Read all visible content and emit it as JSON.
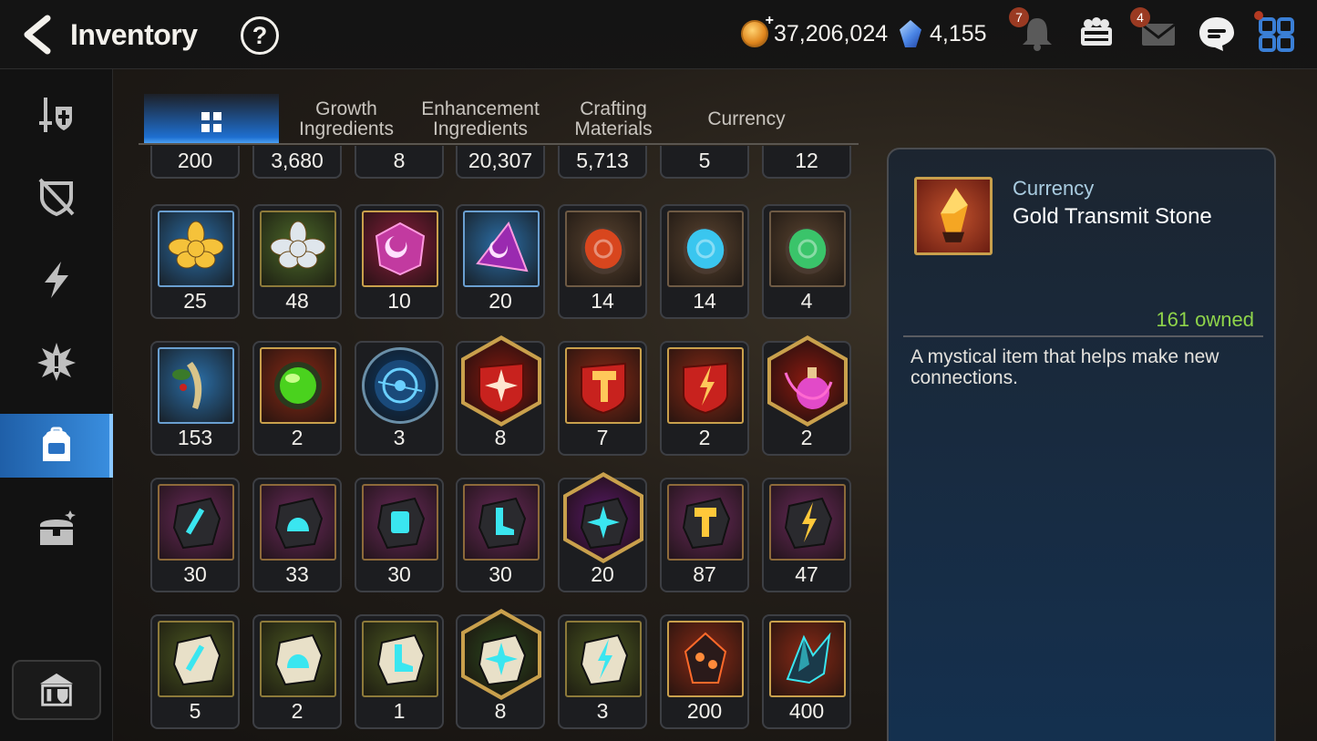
{
  "header": {
    "title": "Inventory",
    "help_label": "?",
    "gold": "37,206,024",
    "crystals": "4,155",
    "notification_count": "7",
    "mail_count": "4"
  },
  "sidebar": {
    "items": [
      {
        "icon": "sword-shield-icon"
      },
      {
        "icon": "broken-shield-icon"
      },
      {
        "icon": "lightning-icon"
      },
      {
        "icon": "burst-icon"
      },
      {
        "icon": "backpack-icon",
        "active": true
      },
      {
        "icon": "treasure-chest-icon"
      }
    ],
    "bottom_icon": "shop-building-icon"
  },
  "tabs": [
    {
      "label": "",
      "icon": "grid-icon",
      "active": true
    },
    {
      "label": "Growth Ingredients"
    },
    {
      "label": "Enhancement Ingredients"
    },
    {
      "label": "Crafting Materials"
    },
    {
      "label": "Currency"
    }
  ],
  "items": [
    {
      "count": "200",
      "style": "plain"
    },
    {
      "count": "3,680",
      "style": "plain"
    },
    {
      "count": "8",
      "style": "plain"
    },
    {
      "count": "20,307",
      "style": "plain"
    },
    {
      "count": "5,713",
      "style": "plain"
    },
    {
      "count": "5",
      "style": "plain"
    },
    {
      "count": "12",
      "style": "plain"
    },
    {
      "count": "25",
      "icon": "gold-flower-icon",
      "bg": "#2b6fa8",
      "style": "blue"
    },
    {
      "count": "48",
      "icon": "silver-flower-icon",
      "bg": "#4d6a2a",
      "style": "green"
    },
    {
      "count": "10",
      "icon": "purple-moon-crystal-icon",
      "bg": "#8a1e3c",
      "style": "red"
    },
    {
      "count": "20",
      "icon": "purple-triangle-crystal-icon",
      "bg": "#2b6fa8",
      "style": "blue"
    },
    {
      "count": "14",
      "icon": "red-rune-stone-icon",
      "bg": "#5a4430",
      "style": "brown"
    },
    {
      "count": "14",
      "icon": "blue-rune-stone-icon",
      "bg": "#5a4430",
      "style": "brown"
    },
    {
      "count": "4",
      "icon": "green-rune-stone-icon",
      "bg": "#5a4430",
      "style": "brown"
    },
    {
      "count": "153",
      "icon": "ginseng-root-icon",
      "bg": "#2b6fa8",
      "style": "blue"
    },
    {
      "count": "2",
      "icon": "green-gem-icon",
      "bg": "#8a2a16",
      "style": "red"
    },
    {
      "count": "3",
      "icon": "blue-circuit-orb-icon",
      "bg": "#0e3a66",
      "style": "round"
    },
    {
      "count": "8",
      "icon": "red-star-shield-icon",
      "bg": "#8a1a10",
      "style": "hex"
    },
    {
      "count": "7",
      "icon": "red-hammer-shield-icon",
      "bg": "#8a2a16",
      "style": "red"
    },
    {
      "count": "2",
      "icon": "red-bolt-shield-icon",
      "bg": "#8a2a16",
      "style": "red"
    },
    {
      "count": "2",
      "icon": "pink-potion-icon",
      "bg": "#8a1a10",
      "style": "hex"
    },
    {
      "count": "30",
      "icon": "cyan-sword-stone-icon",
      "bg": "#6a2a5a",
      "style": "purple"
    },
    {
      "count": "33",
      "icon": "cyan-helmet-stone-icon",
      "bg": "#6a2a5a",
      "style": "purple"
    },
    {
      "count": "30",
      "icon": "cyan-armor-stone-icon",
      "bg": "#6a2a5a",
      "style": "purple"
    },
    {
      "count": "30",
      "icon": "cyan-boot-stone-icon",
      "bg": "#6a2a5a",
      "style": "purple"
    },
    {
      "count": "20",
      "icon": "cyan-star-stone-icon",
      "bg": "#5a1a6a",
      "style": "hex"
    },
    {
      "count": "87",
      "icon": "gold-hammer-stone-icon",
      "bg": "#6a2a5a",
      "style": "purple"
    },
    {
      "count": "47",
      "icon": "gold-bolt-stone-icon",
      "bg": "#6a2a5a",
      "style": "purple"
    },
    {
      "count": "5",
      "icon": "white-sword-stone-icon",
      "bg": "#4d5a22",
      "style": "green"
    },
    {
      "count": "2",
      "icon": "white-helmet-stone-icon",
      "bg": "#4d5a22",
      "style": "green"
    },
    {
      "count": "1",
      "icon": "white-boot-stone-icon",
      "bg": "#4d5a22",
      "style": "green"
    },
    {
      "count": "8",
      "icon": "white-star-stone-icon",
      "bg": "#2a4a1e",
      "style": "hex"
    },
    {
      "count": "3",
      "icon": "white-bolt-stone-icon",
      "bg": "#4d5a22",
      "style": "green"
    },
    {
      "count": "200",
      "icon": "dark-crystal-icon",
      "bg": "#8a2a16",
      "style": "red"
    },
    {
      "count": "400",
      "icon": "dark-crystal-cluster-icon",
      "bg": "#8a2a16",
      "style": "red"
    }
  ],
  "detail": {
    "category": "Currency",
    "name": "Gold Transmit Stone",
    "owned": "161 owned",
    "description": "A mystical item that helps make new connections.",
    "icon": "gold-transmit-stone-icon"
  },
  "colors": {
    "accent": "#2f82dc",
    "owned": "#8fd44a",
    "category": "#a9cce0",
    "gold_frame": "#c9a04c"
  }
}
